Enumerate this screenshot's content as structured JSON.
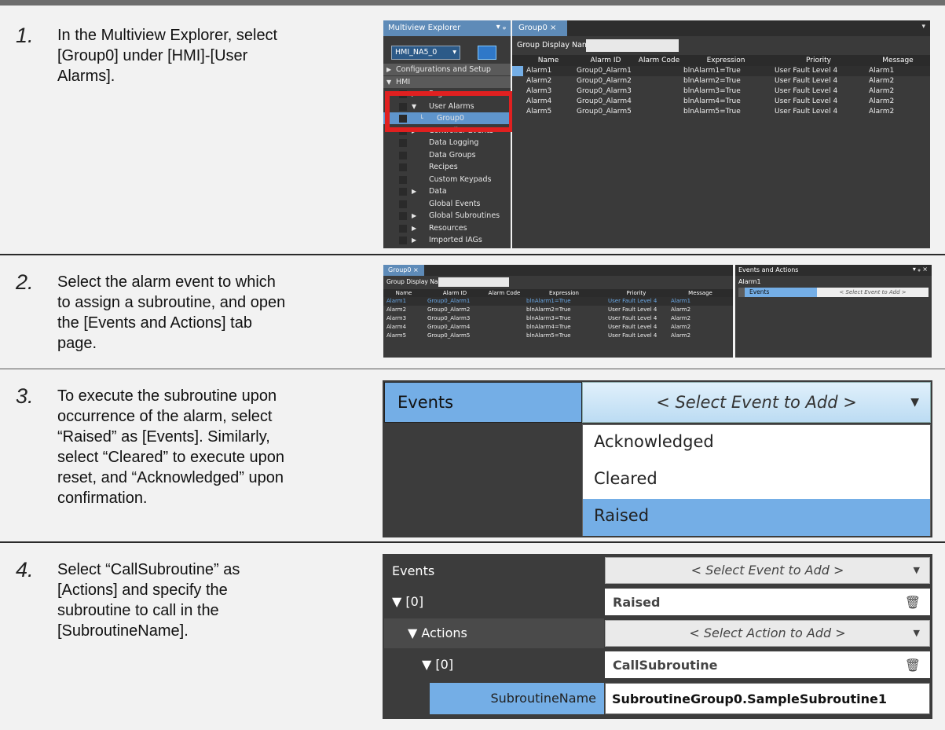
{
  "steps": [
    {
      "number": "1.",
      "lines": [
        "In the Multiview Explorer, select",
        "[Group0] under [HMI]-[User",
        "Alarms]."
      ]
    },
    {
      "number": "2.",
      "lines": [
        "Select the alarm event to which",
        "to assign a subroutine, and open",
        "the [Events and Actions] tab",
        "page."
      ]
    },
    {
      "number": "3.",
      "lines": [
        "To execute the subroutine upon",
        "occurrence of the alarm, select",
        "“Raised” as [Events]. Similarly,",
        "select “Cleared” to execute upon",
        "reset, and “Acknowledged” upon",
        "confirmation."
      ]
    },
    {
      "number": "4.",
      "lines": [
        "Select “CallSubroutine” as",
        "[Actions] and specify the",
        "subroutine to call in the",
        "[SubroutineName]."
      ]
    }
  ],
  "explorer": {
    "title": "Multiview Explorer",
    "pin": "▾ ᵩ",
    "device": "HMI_NA5_0",
    "items": [
      {
        "label": "Configurations and Setup",
        "indent": 0,
        "arrow": "▶"
      },
      {
        "label": "HMI",
        "indent": 0,
        "arrow": "▼"
      },
      {
        "label": "Pages",
        "indent": 1,
        "arrow": "▶"
      },
      {
        "label": "User Alarms",
        "indent": 1,
        "arrow": "▼"
      },
      {
        "label": "Group0",
        "indent": 2,
        "arrow": "└"
      },
      {
        "label": "Controller Events",
        "indent": 1,
        "arrow": "▶"
      },
      {
        "label": "Data Logging",
        "indent": 1,
        "arrow": ""
      },
      {
        "label": "Data Groups",
        "indent": 1,
        "arrow": ""
      },
      {
        "label": "Recipes",
        "indent": 1,
        "arrow": ""
      },
      {
        "label": "Custom Keypads",
        "indent": 1,
        "arrow": ""
      },
      {
        "label": "Data",
        "indent": 1,
        "arrow": "▶"
      },
      {
        "label": "Global Events",
        "indent": 1,
        "arrow": ""
      },
      {
        "label": "Global Subroutines",
        "indent": 1,
        "arrow": "▶"
      },
      {
        "label": "Resources",
        "indent": 1,
        "arrow": "▶"
      },
      {
        "label": "Imported IAGs",
        "indent": 1,
        "arrow": "▶"
      }
    ]
  },
  "group_tab": {
    "label": "Group0 ×",
    "display_name_label": "Group Display Name"
  },
  "alarm_table": {
    "headers": [
      "Name",
      "Alarm ID",
      "Alarm Code",
      "Expression",
      "Priority",
      "Message"
    ],
    "rows": [
      [
        "Alarm1",
        "Group0_Alarm1",
        "",
        "blnAlarm1=True",
        "User Fault Level 4",
        "Alarm1"
      ],
      [
        "Alarm2",
        "Group0_Alarm2",
        "",
        "blnAlarm2=True",
        "User Fault Level 4",
        "Alarm2"
      ],
      [
        "Alarm3",
        "Group0_Alarm3",
        "",
        "blnAlarm3=True",
        "User Fault Level 4",
        "Alarm2"
      ],
      [
        "Alarm4",
        "Group0_Alarm4",
        "",
        "blnAlarm4=True",
        "User Fault Level 4",
        "Alarm2"
      ],
      [
        "Alarm5",
        "Group0_Alarm5",
        "",
        "blnAlarm5=True",
        "User Fault Level 4",
        "Alarm2"
      ]
    ]
  },
  "events_panel": {
    "title": "Events and Actions",
    "subtitle": "Alarm1",
    "events_label": "Events",
    "select_event": "< Select Event to Add >"
  },
  "dropdown": {
    "label": "Events",
    "placeholder": "< Select Event to Add >",
    "options": [
      "Acknowledged",
      "Cleared",
      "Raised"
    ],
    "selected": "Raised"
  },
  "prop_grid": {
    "events_label": "Events",
    "events_placeholder": "< Select Event to Add >",
    "event_index": "▼ [0]",
    "event_value": "Raised",
    "actions_label": "▼ Actions",
    "actions_placeholder": "< Select Action to Add >",
    "action_index": "▼ [0]",
    "action_value": "CallSubroutine",
    "subroutine_label": "SubroutineName",
    "subroutine_value": "SubroutineGroup0.SampleSubroutine1"
  },
  "colors": {
    "highlight": "#74aee6",
    "red_box": "#e02020",
    "dark_bg": "#3a3a3a"
  }
}
